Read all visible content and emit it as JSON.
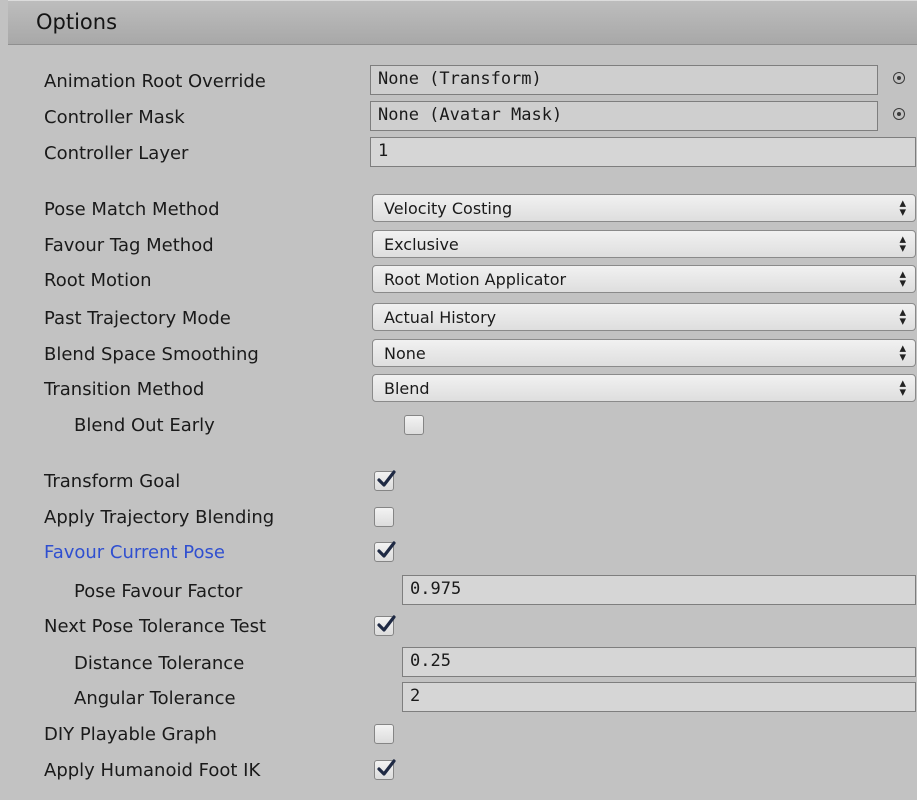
{
  "header": {
    "title": "Options"
  },
  "icons": {
    "object_picker": "object-picker-icon",
    "dropdown_arrows": "updown-arrows-icon",
    "check": "checkmark-icon"
  },
  "fields": {
    "animation_root_override": {
      "label": "Animation Root Override",
      "value": "None (Transform)"
    },
    "controller_mask": {
      "label": "Controller Mask",
      "value": "None (Avatar Mask)"
    },
    "controller_layer": {
      "label": "Controller Layer",
      "value": "1"
    },
    "pose_match_method": {
      "label": "Pose Match Method",
      "value": "Velocity Costing"
    },
    "favour_tag_method": {
      "label": "Favour Tag Method",
      "value": "Exclusive"
    },
    "root_motion": {
      "label": "Root Motion",
      "value": "Root Motion Applicator"
    },
    "past_trajectory_mode": {
      "label": "Past Trajectory Mode",
      "value": "Actual History"
    },
    "blend_space_smoothing": {
      "label": "Blend Space Smoothing",
      "value": "None"
    },
    "transition_method": {
      "label": "Transition Method",
      "value": "Blend"
    },
    "blend_out_early": {
      "label": "Blend Out Early",
      "checked": false
    },
    "transform_goal": {
      "label": "Transform Goal",
      "checked": true
    },
    "apply_trajectory_blending": {
      "label": "Apply Trajectory Blending",
      "checked": false
    },
    "favour_current_pose": {
      "label": "Favour Current Pose",
      "checked": true
    },
    "pose_favour_factor": {
      "label": "Pose Favour Factor",
      "value": "0.975"
    },
    "next_pose_tolerance_test": {
      "label": "Next Pose Tolerance Test",
      "checked": true
    },
    "distance_tolerance": {
      "label": "Distance Tolerance",
      "value": "0.25"
    },
    "angular_tolerance": {
      "label": "Angular Tolerance",
      "value": "2"
    },
    "diy_playable_graph": {
      "label": "DIY Playable Graph",
      "checked": false
    },
    "apply_humanoid_foot_ik": {
      "label": "Apply Humanoid Foot IK",
      "checked": true
    }
  }
}
